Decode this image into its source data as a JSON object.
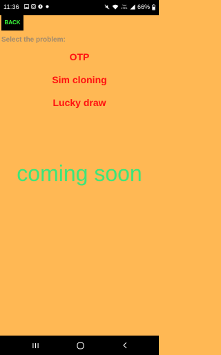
{
  "status_bar": {
    "time": "11:36",
    "network_label": "Voi LTE1",
    "battery": "66%",
    "left_icons": [
      "gallery-icon",
      "instagram-icon",
      "shazam-icon",
      "dot-icon"
    ],
    "right_icons": [
      "mute-icon",
      "wifi-icon",
      "signal-icon",
      "battery-icon"
    ]
  },
  "toolbar": {
    "back_label": "BACK"
  },
  "content": {
    "select_label": "Select the problem:",
    "problems": [
      "OTP",
      "Sim cloning",
      "Lucky draw"
    ],
    "coming_soon": "coming soon"
  },
  "nav_bar": {
    "buttons": [
      "recents-icon",
      "home-icon",
      "back-nav-icon"
    ]
  },
  "colors": {
    "background": "#FFB854",
    "problem_text": "#FF1010",
    "coming_soon_text": "#3CE57A",
    "back_text": "#3CFF3C",
    "label_text": "#A08A6E"
  }
}
